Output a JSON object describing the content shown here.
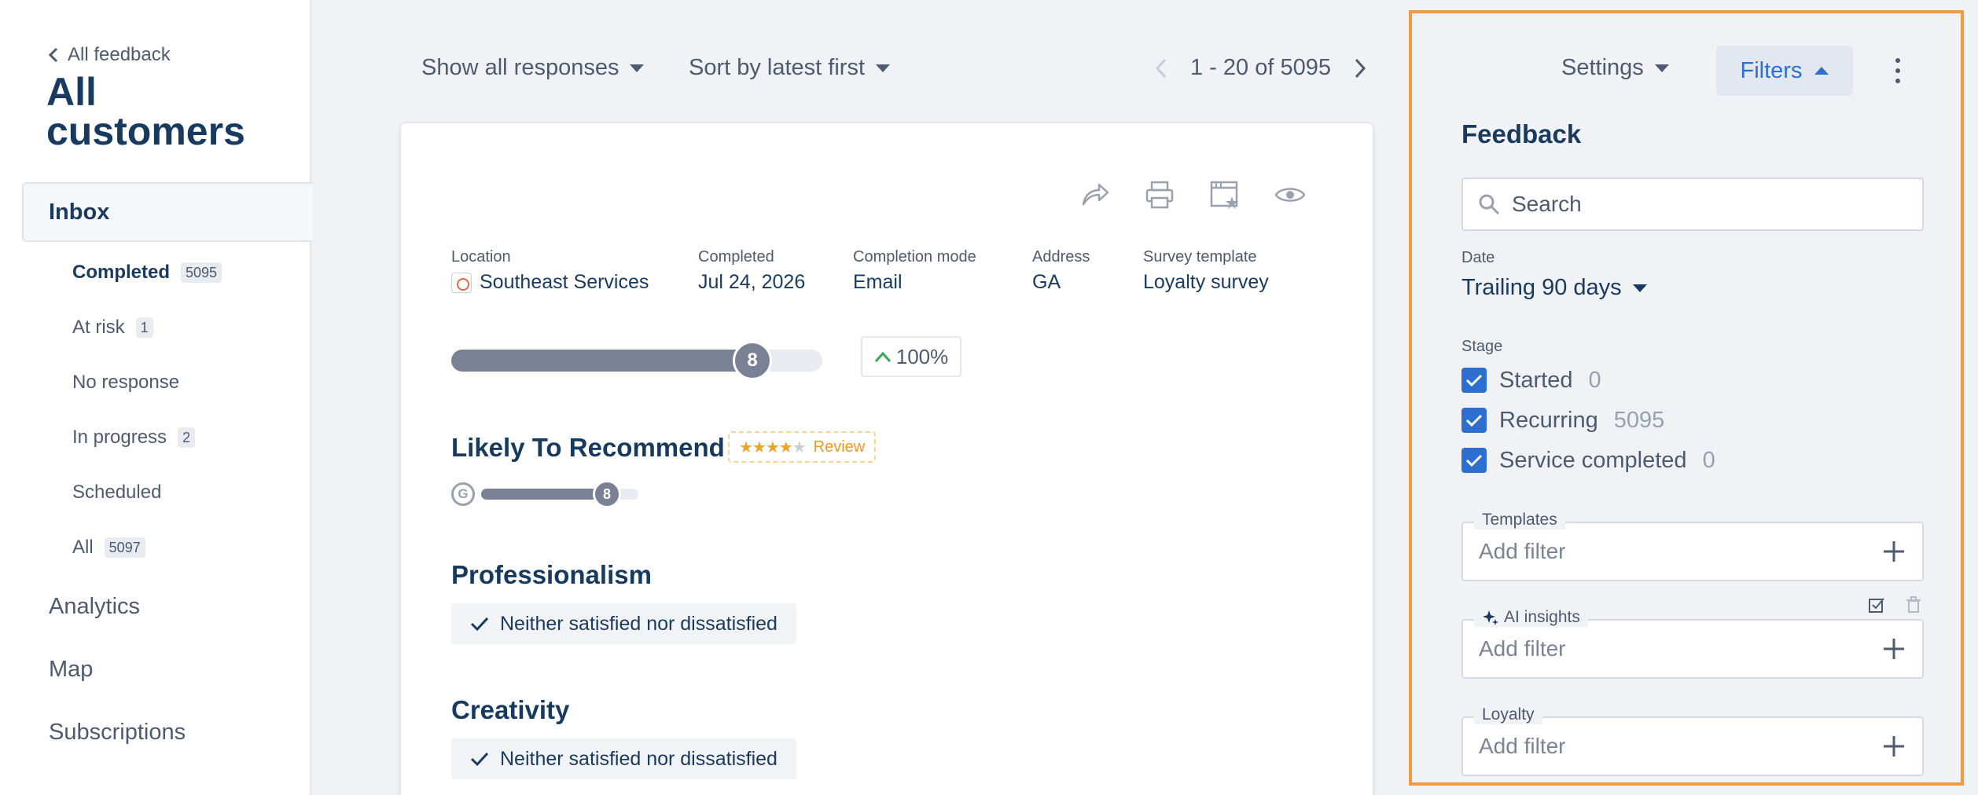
{
  "sidebar": {
    "back_label": "All feedback",
    "title": "All customers",
    "inbox_label": "Inbox",
    "sub_items": [
      {
        "label": "Completed",
        "count": "5095"
      },
      {
        "label": "At risk",
        "count": "1"
      },
      {
        "label": "No response",
        "count": ""
      },
      {
        "label": "In progress",
        "count": "2"
      },
      {
        "label": "Scheduled",
        "count": ""
      },
      {
        "label": "All",
        "count": "5097"
      }
    ],
    "nav": [
      "Analytics",
      "Map",
      "Subscriptions"
    ]
  },
  "toolbar": {
    "show_filter": "Show all responses",
    "sort": "Sort by latest first",
    "pager": "1 - 20 of 5095"
  },
  "card": {
    "icons": [
      "share-icon",
      "print-icon",
      "template-star-icon",
      "eye-icon"
    ],
    "meta": [
      {
        "label": "Location",
        "value": "Southeast Services"
      },
      {
        "label": "Completed",
        "value": "Jul 24, 2026"
      },
      {
        "label": "Completion mode",
        "value": "Email"
      },
      {
        "label": "Address",
        "value": "GA"
      },
      {
        "label": "Survey template",
        "value": "Loyalty survey"
      }
    ],
    "score": {
      "value": "8",
      "max": 10
    },
    "percent_change": "100%",
    "questions": [
      {
        "title": "Likely To Recommend",
        "review_label": "Review",
        "stars": 4,
        "score": "8",
        "source_icon": "G"
      },
      {
        "title": "Professionalism",
        "answer": "Neither satisfied nor dissatisfied"
      },
      {
        "title": "Creativity",
        "answer": "Neither satisfied nor dissatisfied"
      }
    ]
  },
  "panel": {
    "settings_label": "Settings",
    "filters_label": "Filters",
    "title": "Feedback",
    "search_placeholder": "Search",
    "date_label": "Date",
    "date_value": "Trailing 90 days",
    "stage_label": "Stage",
    "stages": [
      {
        "label": "Started",
        "count": "0",
        "checked": true
      },
      {
        "label": "Recurring",
        "count": "5095",
        "checked": true
      },
      {
        "label": "Service completed",
        "count": "0",
        "checked": true
      }
    ],
    "filters": [
      {
        "legend": "Templates",
        "placeholder": "Add filter"
      },
      {
        "legend": "AI insights",
        "placeholder": "Add filter"
      },
      {
        "legend": "Loyalty",
        "placeholder": "Add filter"
      }
    ]
  },
  "colors": {
    "accent": "#2c6fd1",
    "highlight": "#f19a3e",
    "text": "#193a5f",
    "muted": "#4e5a6d"
  }
}
